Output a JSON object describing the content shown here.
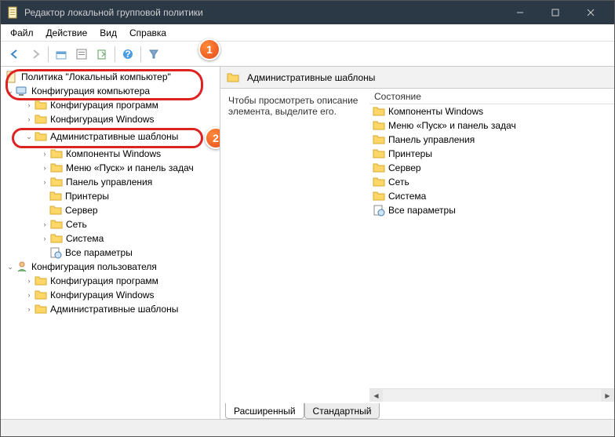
{
  "titlebar": {
    "text": "Редактор локальной групповой политики"
  },
  "menu": {
    "file": "Файл",
    "action": "Действие",
    "view": "Вид",
    "help": "Справка"
  },
  "tree": {
    "root": "Политика \"Локальный компьютер\"",
    "compCfg": "Конфигурация компьютера",
    "compSoft": "Конфигурация программ",
    "compWin": "Конфигурация Windows",
    "adminT": "Административные шаблоны",
    "winComp": "Компоненты Windows",
    "startMenu": "Меню «Пуск» и панель задач",
    "ctrlPanel": "Панель управления",
    "printers": "Принтеры",
    "server": "Сервер",
    "network": "Сеть",
    "system": "Система",
    "allSettings": "Все параметры",
    "userCfg": "Конфигурация пользователя",
    "userSoft": "Конфигурация программ",
    "userWin": "Конфигурация Windows",
    "userAdmin": "Административные шаблоны"
  },
  "right": {
    "headerTitle": "Административные шаблоны",
    "desc": "Чтобы просмотреть описание элемента, выделите его.",
    "colState": "Состояние",
    "items": {
      "i1": "Компоненты Windows",
      "i2": "Меню «Пуск» и панель задач",
      "i3": "Панель управления",
      "i4": "Принтеры",
      "i5": "Сервер",
      "i6": "Сеть",
      "i7": "Система",
      "i8": "Все параметры"
    }
  },
  "tabs": {
    "ext": "Расширенный",
    "std": "Стандартный"
  },
  "callouts": {
    "c1": "1",
    "c2": "2"
  }
}
